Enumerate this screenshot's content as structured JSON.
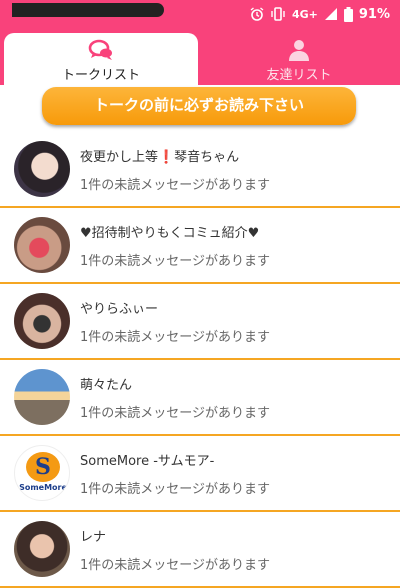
{
  "status_bar": {
    "network": "4G+",
    "battery": "91%",
    "icons": [
      "alarm-icon",
      "vibrate-icon",
      "signal-icon",
      "battery-icon"
    ]
  },
  "tabs": [
    {
      "label": "トークリスト",
      "icon": "chat-bubbles-icon",
      "active": true
    },
    {
      "label": "友達リスト",
      "icon": "person-icon",
      "active": false
    }
  ],
  "notice_button": {
    "label": "トークの前に必ずお読み下さい"
  },
  "colors": {
    "brand": "#f9427b",
    "accent": "#f5a623"
  },
  "talk_list": [
    {
      "title": "夜更かし上等❗琴音ちゃん",
      "message": "1件の未読メッセージがあります"
    },
    {
      "title": "♥招待制やりもくコミュ紹介♥",
      "message": "1件の未読メッセージがあります"
    },
    {
      "title": "やりらふぃー",
      "message": "1件の未読メッセージがあります"
    },
    {
      "title": "萌々たん",
      "message": "1件の未読メッセージがあります"
    },
    {
      "title": "SomeMore -サムモア-",
      "message": "1件の未読メッセージがあります",
      "logo_letter": "S",
      "logo_text": "SomeMore"
    },
    {
      "title": "レナ",
      "message": "1件の未読メッセージがあります"
    }
  ]
}
